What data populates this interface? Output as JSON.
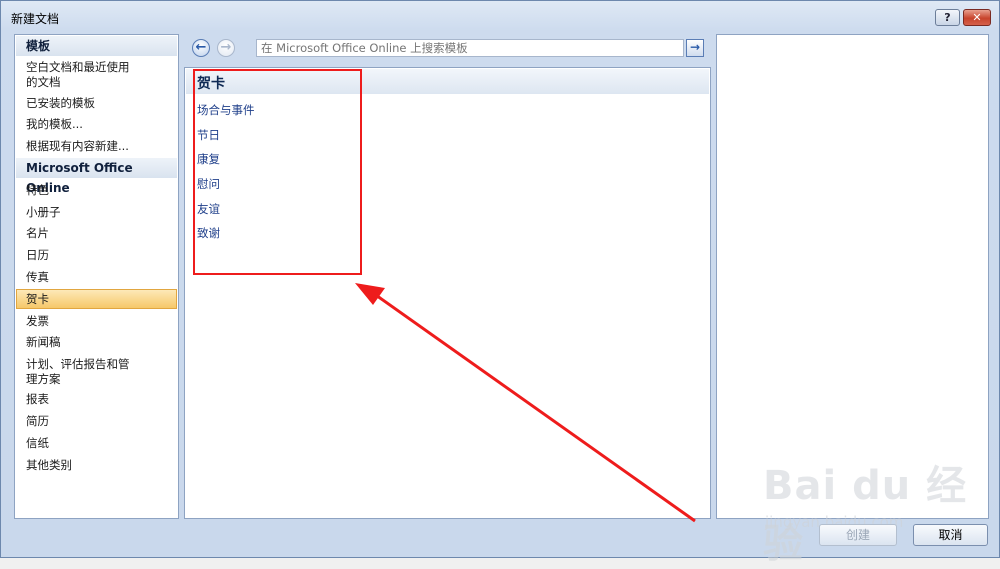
{
  "window": {
    "title": "新建文档",
    "help_label": "?",
    "close_label": "✕"
  },
  "left_panel": {
    "templates_header": "模板",
    "template_items": [
      "空白文档和最近使用",
      "的文档",
      "已安装的模板",
      "我的模板...",
      "根据现有内容新建..."
    ],
    "online_header": "Microsoft Office Online",
    "online_items": [
      "特色",
      "小册子",
      "名片",
      "日历",
      "传真",
      "贺卡",
      "发票",
      "新闻稿",
      "计划、评估报告和管",
      "理方案",
      "报表",
      "简历",
      "信纸",
      "其他类别"
    ],
    "selected_item": "贺卡"
  },
  "nav": {
    "search_placeholder": "在 Microsoft Office Online 上搜索模板",
    "back_icon": "back-arrow-icon",
    "forward_icon": "forward-arrow-icon",
    "go_icon": "go-arrow-icon"
  },
  "middle_panel": {
    "title": "贺卡",
    "categories": [
      "场合与事件",
      "节日",
      "康复",
      "慰问",
      "友谊",
      "致谢"
    ]
  },
  "buttons": {
    "create_label": "创建",
    "cancel_label": "取消"
  },
  "annotation": {
    "box_color": "#ee1c1c",
    "arrow_color": "#ee1c1c"
  },
  "watermark": {
    "logo": "Bai du 经验",
    "text": "jingyan.baidu.com"
  }
}
